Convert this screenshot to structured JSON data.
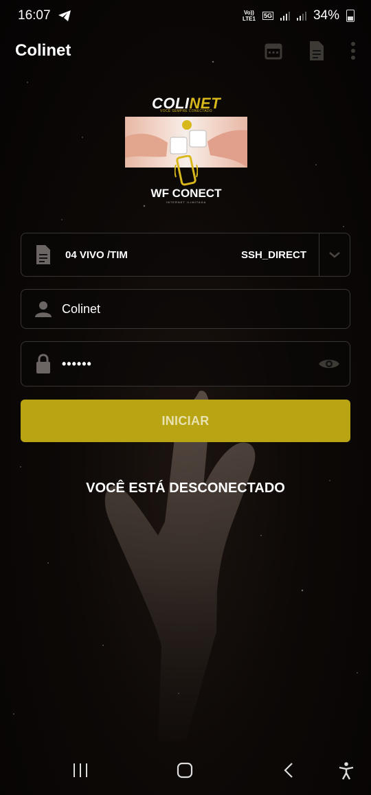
{
  "status_bar": {
    "time": "16:07",
    "net_top": "Vo))",
    "net_bottom": "LTE1",
    "badge_5g": "5G",
    "battery": "34%"
  },
  "app_bar": {
    "title": "Colinet"
  },
  "logo": {
    "brand_prefix": "COLI",
    "brand_suffix": "NET",
    "tagline": "VOCÊ SEMPRE CONECTADO",
    "sub_brand": "WF CONECT",
    "sub_tagline": "INTERNET ILIMITADA"
  },
  "form": {
    "server_name": "04 VIVO /TIM",
    "server_type": "SSH_DIRECT",
    "username": "Colinet",
    "password_masked": "••••••",
    "start_label": "INICIAR"
  },
  "connection_status": "VOCÊ ESTÁ DESCONECTADO",
  "colors": {
    "accent": "#b9a413",
    "background": "#0a0706",
    "field_border": "#3a3633"
  }
}
